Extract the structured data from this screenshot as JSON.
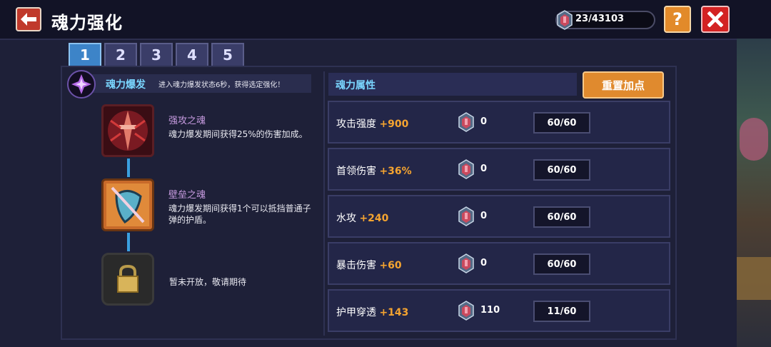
{
  "header": {
    "title": "魂力强化",
    "currency": "23/43103",
    "help_label": "?"
  },
  "tabs": [
    {
      "label": "1",
      "active": true
    },
    {
      "label": "2",
      "active": false
    },
    {
      "label": "3",
      "active": false
    },
    {
      "label": "4",
      "active": false
    },
    {
      "label": "5",
      "active": false
    }
  ],
  "burst": {
    "title": "魂力爆发",
    "desc": "进入魂力爆发状态6秒，获得选定强化！"
  },
  "skills": [
    {
      "name": "强攻之魂",
      "desc": "魂力爆发期间获得25%的伤害加成。",
      "icon": "sword-soul-icon"
    },
    {
      "name": "壁垒之魂",
      "desc": "魂力爆发期间获得1个可以抵挡普通子弹的护盾。",
      "icon": "shield-soul-icon"
    },
    {
      "name": "",
      "desc": "暂未开放，敬请期待",
      "icon": "lock-icon"
    }
  ],
  "attributes": {
    "header": "魂力属性",
    "reset_label": "重置加点",
    "rows": [
      {
        "name": "攻击强度",
        "bonus": "+900",
        "count": "0",
        "level": "60/60"
      },
      {
        "name": "首领伤害",
        "bonus": "+36%",
        "count": "0",
        "level": "60/60"
      },
      {
        "name": "水攻",
        "bonus": "+240",
        "count": "0",
        "level": "60/60"
      },
      {
        "name": "暴击伤害",
        "bonus": "+60",
        "count": "0",
        "level": "60/60"
      },
      {
        "name": "护甲穿透",
        "bonus": "+143",
        "count": "110",
        "level": "11/60"
      }
    ]
  },
  "colors": {
    "accent_blue": "#3d84c8",
    "bonus_orange": "#f5a430",
    "button_orange": "#e08a2e",
    "close_red": "#d32222"
  }
}
